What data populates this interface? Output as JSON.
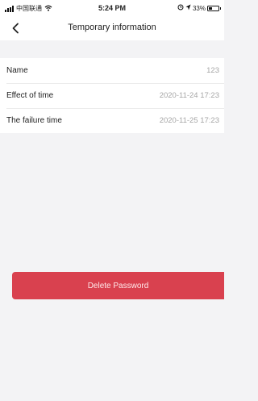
{
  "status_bar": {
    "carrier": "中国联通",
    "time": "5:24 PM",
    "battery_percent": "33%",
    "icons": [
      "signal-icon",
      "wifi-icon",
      "alarm-icon",
      "location-icon",
      "battery-icon"
    ]
  },
  "nav": {
    "back_icon": "chevron-left-icon",
    "title": "Temporary information"
  },
  "info": {
    "rows": [
      {
        "label": "Name",
        "value": "123"
      },
      {
        "label": "Effect of time",
        "value": "2020-11-24 17:23"
      },
      {
        "label": "The failure time",
        "value": "2020-11-25 17:23"
      }
    ]
  },
  "actions": {
    "delete_label": "Delete Password"
  },
  "colors": {
    "accent": "#d9414f",
    "background": "#f3f3f5",
    "value_text": "#a6a6a6"
  }
}
